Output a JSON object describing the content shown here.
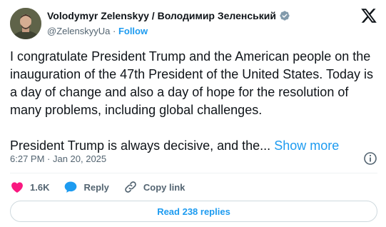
{
  "author": {
    "display_name": "Volodymyr Zelenskyy / Володимир Зеленський",
    "handle": "@ZelenskyyUa",
    "separator": "·",
    "follow_label": "Follow",
    "verified_color": "#829aab"
  },
  "tweet": {
    "paragraph1": "I congratulate President Trump and the American people on the inauguration of the 47th President of the United States. Today is a day of change and also a day of hope for the resolution of many problems, including global challenges.",
    "paragraph2": "President Trump is always decisive, and the...",
    "show_more_label": "Show more",
    "timestamp": "6:27 PM · Jan 20, 2025"
  },
  "actions": {
    "likes": "1.6K",
    "reply_label": "Reply",
    "copy_link_label": "Copy link"
  },
  "read_replies_label": "Read 238 replies",
  "colors": {
    "accent": "#1d9bf0",
    "like": "#f91880",
    "text": "#0f1419",
    "secondary": "#536471"
  },
  "icons": {
    "logo": "x-logo-icon",
    "info": "info-icon",
    "like": "heart-icon",
    "reply": "speech-bubble-icon",
    "copy_link": "link-icon",
    "verified": "verified-badge-icon"
  }
}
